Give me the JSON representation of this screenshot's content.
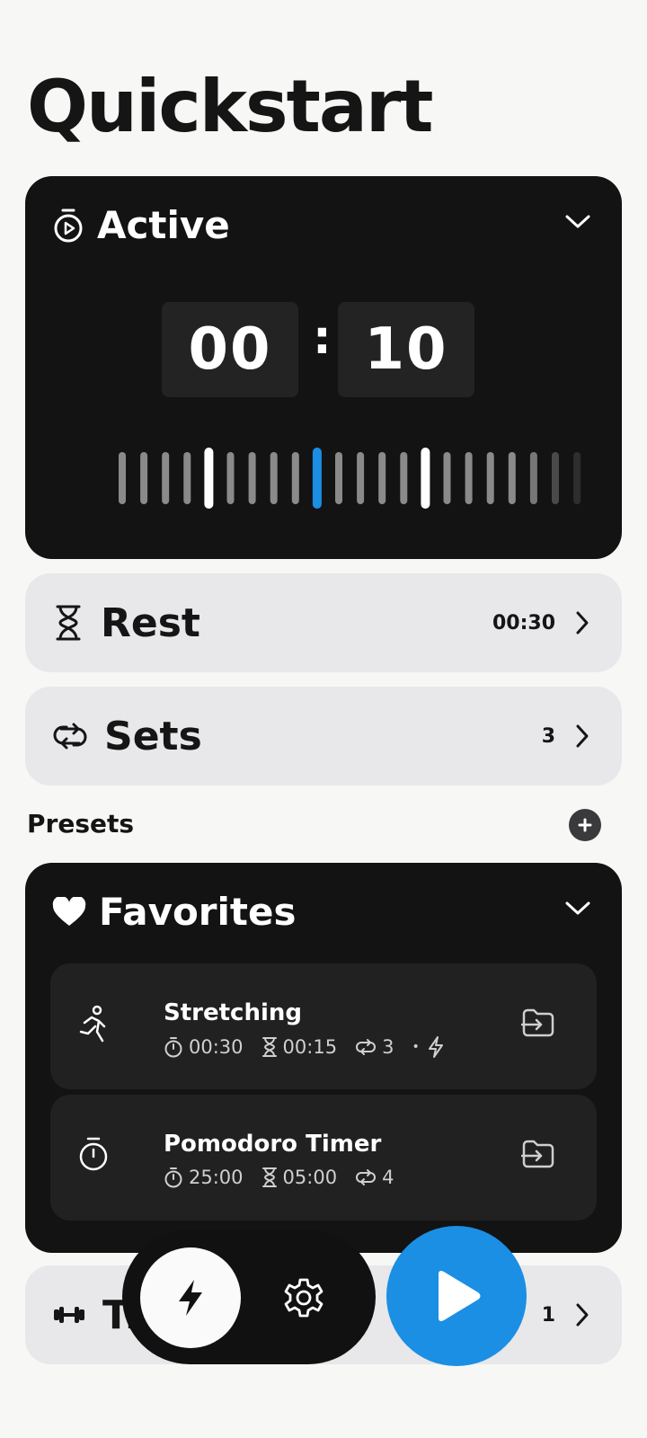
{
  "page": {
    "title": "Quickstart"
  },
  "active": {
    "label": "Active",
    "minutes": "00",
    "seconds": "10",
    "separator": ":",
    "highlight_color": "#1a8fe3"
  },
  "rest": {
    "label": "Rest",
    "value": "00:30"
  },
  "sets": {
    "label": "Sets",
    "value": "3"
  },
  "presets": {
    "label": "Presets"
  },
  "favorites": {
    "label": "Favorites",
    "items": [
      {
        "name": "Stretching",
        "icon": "running-person-icon",
        "active": "00:30",
        "rest": "00:15",
        "sets": "3",
        "bullet": "•",
        "quick": true
      },
      {
        "name": "Pomodoro Timer",
        "icon": "stopwatch-icon",
        "active": "25:00",
        "rest": "05:00",
        "sets": "4",
        "quick": false
      }
    ]
  },
  "training": {
    "label": "Tr",
    "value": "1"
  },
  "nav": {
    "bolt": "bolt-icon",
    "settings": "gear-icon",
    "play": "play-icon",
    "accent": "#1a8fe3"
  }
}
